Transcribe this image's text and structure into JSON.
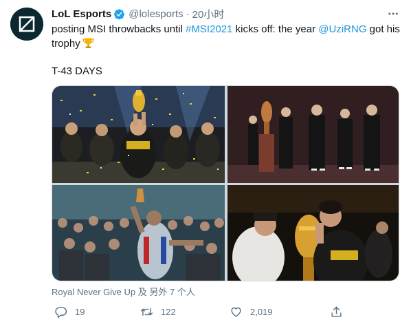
{
  "tweet": {
    "author": {
      "display_name": "LoL Esports",
      "handle": "@lolesports",
      "verified": true,
      "avatar_icon": "lol-esports-logo-icon"
    },
    "separator": "·",
    "timestamp": "20小时",
    "text": {
      "part1": "posting MSI throwbacks until ",
      "hashtag": "#MSI2021",
      "part2": " kicks off: the year ",
      "mention": "@UziRNG",
      "part3": " got his trophy",
      "emoji": "trophy-emoji"
    },
    "countdown": "T-43 DAYS",
    "media": [
      {
        "name": "photo-trophy-lift-confetti",
        "icon": "photo"
      },
      {
        "name": "photo-team-on-stage-with-trophy",
        "icon": "photo"
      },
      {
        "name": "photo-crowd-and-body-painted-fan",
        "icon": "photo"
      },
      {
        "name": "photo-player-kissing-trophy",
        "icon": "photo"
      }
    ],
    "tagged": "Royal Never Give Up 及 另外 7 个人",
    "actions": {
      "reply_count": "19",
      "retweet_count": "122",
      "like_count": "2,019",
      "reply_icon": "reply-icon",
      "retweet_icon": "retweet-icon",
      "like_icon": "heart-icon",
      "share_icon": "share-icon"
    },
    "colors": {
      "link": "#1b95e0",
      "secondary_text": "#5b7083",
      "verified": "#1da1f2",
      "avatar_bg": "#0b2730"
    }
  }
}
